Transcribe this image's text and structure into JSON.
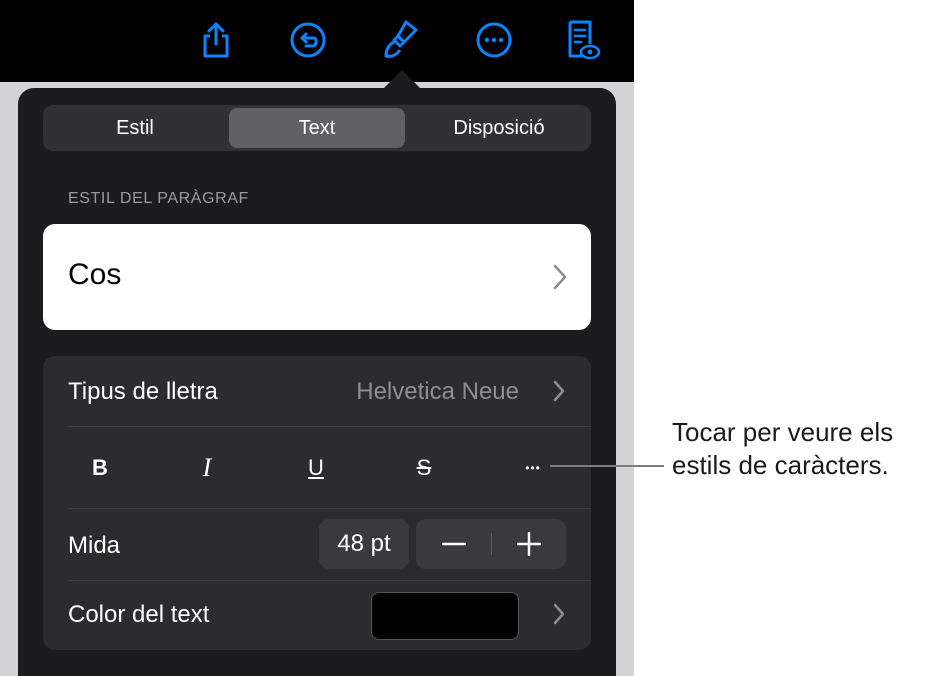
{
  "toolbar": {
    "icons": [
      "share-icon",
      "undo-icon",
      "paintbrush-icon",
      "more-icon",
      "reader-view-icon"
    ],
    "accent_color": "#0a84ff"
  },
  "tabs": [
    {
      "label": "Estil",
      "active": false
    },
    {
      "label": "Text",
      "active": true
    },
    {
      "label": "Disposició",
      "active": false
    }
  ],
  "paragraph_style": {
    "header": "ESTIL DEL PARÀGRAF",
    "value": "Cos"
  },
  "font": {
    "label": "Tipus de lletra",
    "value": "Helvetica Neue",
    "styles": [
      {
        "name": "bold",
        "glyph": "B"
      },
      {
        "name": "italic",
        "glyph": "I"
      },
      {
        "name": "underline",
        "glyph": "U"
      },
      {
        "name": "strikethrough",
        "glyph": "S"
      },
      {
        "name": "more",
        "glyph": "•••"
      }
    ]
  },
  "size": {
    "label": "Mida",
    "value": "48 pt",
    "minus": "−",
    "plus": "+"
  },
  "text_color": {
    "label": "Color del text",
    "color": "#000000"
  },
  "callout": {
    "line1": "Tocar per veure els",
    "line2": "estils de caràcters."
  }
}
